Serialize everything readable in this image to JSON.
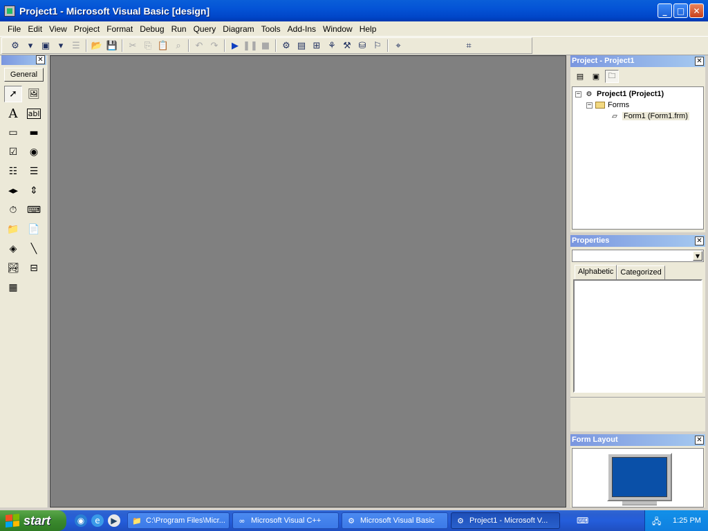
{
  "window": {
    "title": "Project1 - Microsoft Visual Basic [design]",
    "minimize": "_",
    "maximize": "□",
    "close": "✕"
  },
  "menu": [
    "File",
    "Edit",
    "View",
    "Project",
    "Format",
    "Debug",
    "Run",
    "Query",
    "Diagram",
    "Tools",
    "Add-Ins",
    "Window",
    "Help"
  ],
  "toolbox": {
    "tab_label": "General",
    "close": "✕"
  },
  "project_panel": {
    "title": "Project - Project1",
    "close": "✕",
    "tree": {
      "project": "Project1 (Project1)",
      "folder": "Forms",
      "form": "Form1 (Form1.frm)"
    }
  },
  "properties_panel": {
    "title": "Properties",
    "close": "✕",
    "object_value": "",
    "tabs": [
      "Alphabetic",
      "Categorized"
    ]
  },
  "layout_panel": {
    "title": "Form Layout",
    "close": "✕"
  },
  "taskbar": {
    "start": "start",
    "buttons": [
      {
        "label": "C:\\Program Files\\Micr...",
        "icon": "folder-icon"
      },
      {
        "label": "Microsoft Visual C++",
        "icon": "vc-icon"
      },
      {
        "label": "Microsoft Visual Basic",
        "icon": "vb-icon"
      },
      {
        "label": "Project1 - Microsoft V...",
        "icon": "vb-project-icon"
      }
    ],
    "clock": "1:25 PM"
  }
}
